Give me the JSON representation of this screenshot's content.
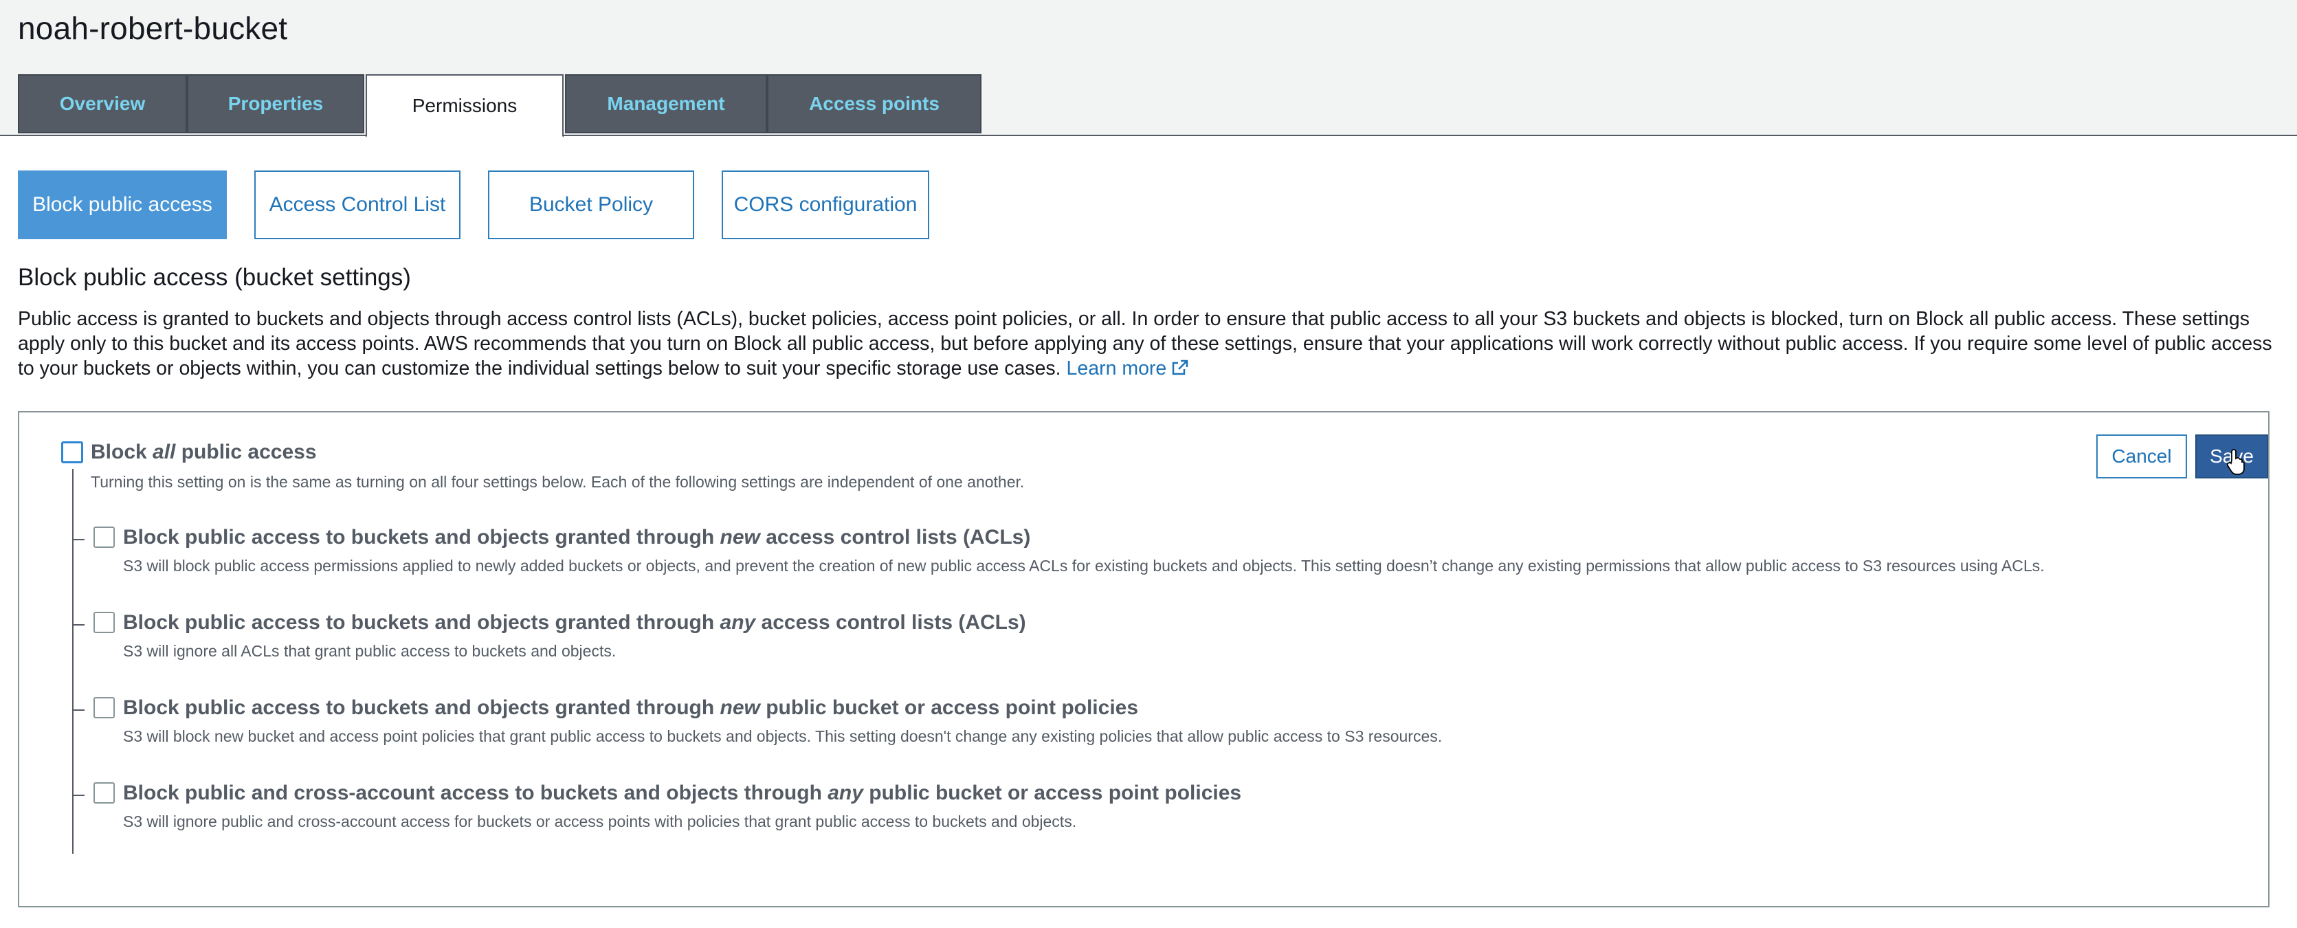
{
  "bucket_name": "noah-robert-bucket",
  "tabs": [
    {
      "label": "Overview"
    },
    {
      "label": "Properties"
    },
    {
      "label": "Permissions",
      "active": true
    },
    {
      "label": "Management"
    },
    {
      "label": "Access points"
    }
  ],
  "subtabs": [
    {
      "label": "Block public access",
      "active": true
    },
    {
      "label": "Access Control List"
    },
    {
      "label": "Bucket Policy"
    },
    {
      "label": "CORS configuration"
    }
  ],
  "section": {
    "title": "Block public access (bucket settings)",
    "description": "Public access is granted to buckets and objects through access control lists (ACLs), bucket policies, access point policies, or all. In order to ensure that public access to all your S3 buckets and objects is blocked, turn on Block all public access. These settings apply only to this bucket and its access points. AWS recommends that you turn on Block all public access, but before applying any of these settings, ensure that your applications will work correctly without public access. If you require some level of public access to your buckets or objects within, you can customize the individual settings below to suit your specific storage use cases.",
    "learn_more": "Learn more",
    "ext_icon": "external-link-icon"
  },
  "master": {
    "label_pre": "Block ",
    "label_em": "all",
    "label_post": " public access",
    "description": "Turning this setting on is the same as turning on all four settings below. Each of the following settings are independent of one another.",
    "checked": false
  },
  "options": [
    {
      "label_pre": "Block public access to buckets and objects granted through ",
      "label_em": "new",
      "label_post": " access control lists (ACLs)",
      "description": "S3 will block public access permissions applied to newly added buckets or objects, and prevent the creation of new public access ACLs for existing buckets and objects. This setting doesn’t change any existing permissions that allow public access to S3 resources using ACLs.",
      "checked": false
    },
    {
      "label_pre": "Block public access to buckets and objects granted through ",
      "label_em": "any",
      "label_post": " access control lists (ACLs)",
      "description": "S3 will ignore all ACLs that grant public access to buckets and objects.",
      "checked": false
    },
    {
      "label_pre": "Block public access to buckets and objects granted through ",
      "label_em": "new",
      "label_post": " public bucket or access point policies",
      "description": "S3 will block new bucket and access point policies that grant public access to buckets and objects. This setting doesn't change any existing policies that allow public access to S3 resources.",
      "checked": false
    },
    {
      "label_pre": "Block public and cross-account access to buckets and objects through ",
      "label_em": "any",
      "label_post": " public bucket or access point policies",
      "description": "S3 will ignore public and cross-account access for buckets or access points with policies that grant public access to buckets and objects.",
      "checked": false
    }
  ],
  "actions": {
    "cancel": "Cancel",
    "save": "Save"
  },
  "colors": {
    "tab_bg": "#545b64",
    "tab_text": "#7ad4f0",
    "accent": "#1f73b7",
    "primary": "#2f5e9c"
  }
}
